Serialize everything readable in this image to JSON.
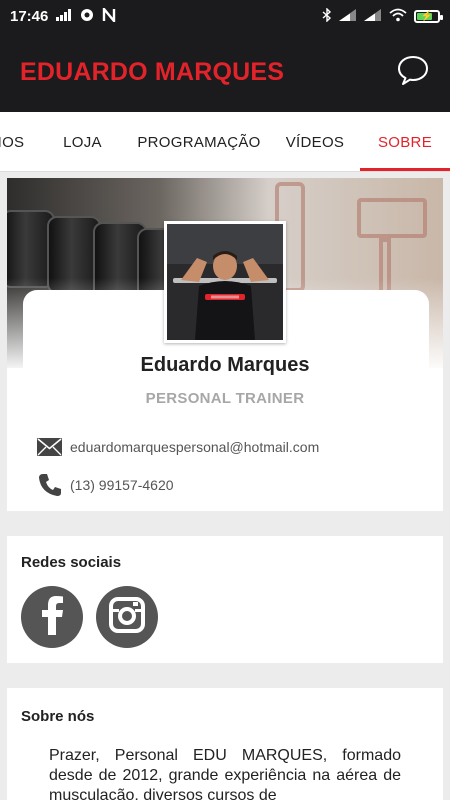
{
  "status_bar": {
    "time": "17:46",
    "battery_level": 0.7
  },
  "header": {
    "title": "EDUARDO MARQUES"
  },
  "tabs": [
    {
      "label": "IOS",
      "active": false
    },
    {
      "label": "LOJA",
      "active": false
    },
    {
      "label": "PROGRAMAÇÃO",
      "active": false
    },
    {
      "label": "VÍDEOS",
      "active": false
    },
    {
      "label": "SOBRE",
      "active": true
    }
  ],
  "profile": {
    "name": "Eduardo Marques",
    "role": "PERSONAL TRAINER",
    "email": "eduardomarquespersonal@hotmail.com",
    "phone": "(13) 99157-4620"
  },
  "social": {
    "title": "Redes sociais",
    "items": [
      {
        "name": "facebook",
        "glyph": "f"
      },
      {
        "name": "instagram",
        "glyph": ""
      }
    ]
  },
  "about": {
    "title": "Sobre nós",
    "text": "Prazer, Personal EDU MARQUES, formado desde de 2012, grande experiência na aérea de musculação, diversos cursos de"
  },
  "colors": {
    "accent": "#e3232a",
    "header_bg": "#1b1b1d",
    "social_icon_bg": "#555555"
  }
}
